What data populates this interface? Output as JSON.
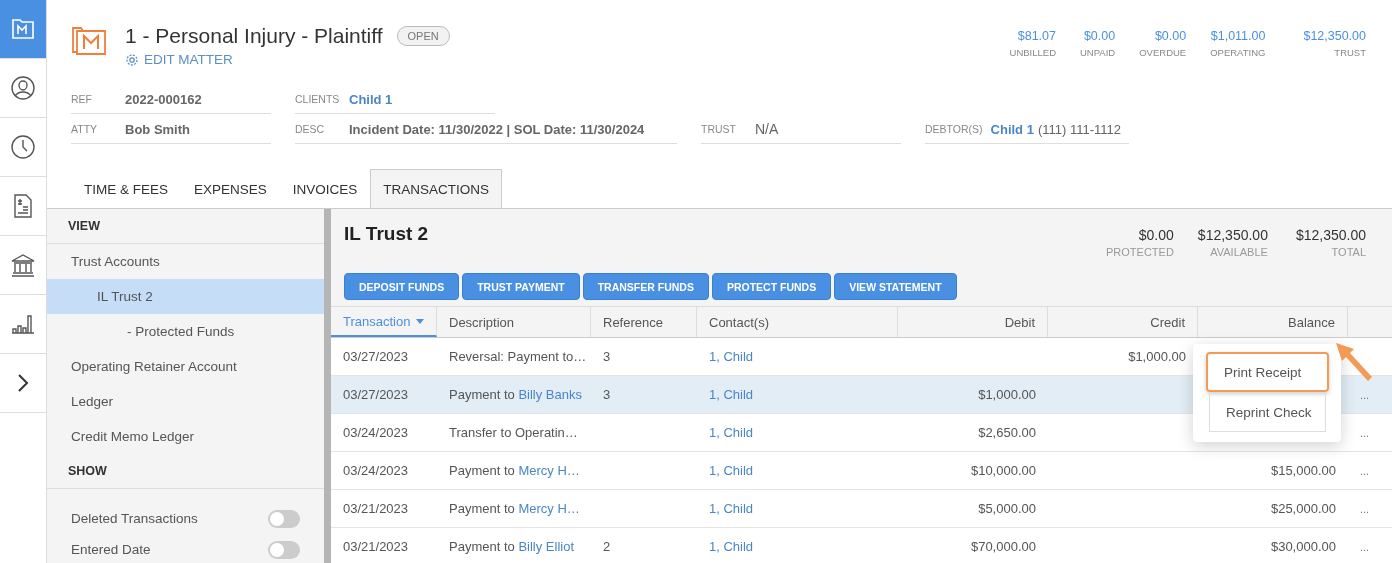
{
  "rail": [
    {
      "kind": "matter",
      "selected": true
    },
    {
      "kind": "contacts",
      "selected": false
    },
    {
      "kind": "time",
      "selected": false
    },
    {
      "kind": "invoice",
      "selected": false
    },
    {
      "kind": "bank",
      "selected": false
    },
    {
      "kind": "reports",
      "selected": false
    },
    {
      "kind": "expand",
      "selected": false
    }
  ],
  "matter": {
    "title": "1 - Personal Injury - Plaintiff",
    "status": "OPEN",
    "edit_link": "EDIT MATTER"
  },
  "stats": [
    {
      "value": "$81.07",
      "label": "UNBILLED"
    },
    {
      "value": "$0.00",
      "label": "UNPAID"
    },
    {
      "value": "$0.00",
      "label": "OVERDUE"
    },
    {
      "value": "$1,011.00",
      "label": "OPERATING"
    },
    {
      "value": "$12,350.00",
      "label": "TRUST"
    }
  ],
  "fields": [
    [
      {
        "label": "REF",
        "value": "2022-000162"
      },
      {
        "label": "CLIENTS",
        "link": "Child 1"
      }
    ],
    [
      {
        "label": "ATTY",
        "value": "Bob Smith"
      },
      {
        "label": "DESC",
        "value": "Incident Date: 11/30/2022 | SOL Date: 11/30/2024"
      },
      {
        "label": "TRUST",
        "value": "N/A"
      },
      {
        "label": "DEBTOR(S)",
        "link": "Child 1",
        "value": "(111) 111-1112"
      }
    ]
  ],
  "tabs": [
    {
      "label": "TIME & FEES",
      "selected": false
    },
    {
      "label": "EXPENSES",
      "selected": false
    },
    {
      "label": "INVOICES",
      "selected": false
    },
    {
      "label": "TRANSACTIONS",
      "selected": true
    }
  ],
  "sidebar": {
    "view_heading": "VIEW",
    "items": [
      {
        "label": "Trust Accounts",
        "selected": false,
        "children": [
          {
            "label": "IL Trust 2",
            "selected": true,
            "children": [
              {
                "label": "- Protected Funds",
                "selected": false
              }
            ]
          }
        ]
      },
      {
        "label": "Operating Retainer Account",
        "selected": false
      },
      {
        "label": "Ledger",
        "selected": false
      },
      {
        "label": "Credit Memo Ledger",
        "selected": false
      }
    ],
    "show_heading": "SHOW",
    "toggles": [
      {
        "label": "Deleted Transactions",
        "on": false
      },
      {
        "label": "Entered Date",
        "on": false
      }
    ]
  },
  "account": {
    "title": "IL Trust 2",
    "summary": [
      {
        "value": "$0.00",
        "label": "PROTECTED"
      },
      {
        "value": "$12,350.00",
        "label": "AVAILABLE"
      },
      {
        "value": "$12,350.00",
        "label": "TOTAL"
      }
    ],
    "buttons": [
      "DEPOSIT FUNDS",
      "TRUST PAYMENT",
      "TRANSFER FUNDS",
      "PROTECT FUNDS",
      "VIEW STATEMENT"
    ]
  },
  "table": {
    "columns": [
      {
        "label": "Transaction",
        "sorted": true
      },
      {
        "label": "Description",
        "sorted": false
      },
      {
        "label": "Reference",
        "sorted": false
      },
      {
        "label": "Contact(s)",
        "sorted": false
      },
      {
        "label": "Debit",
        "sorted": false
      },
      {
        "label": "Credit",
        "sorted": false
      },
      {
        "label": "Balance",
        "sorted": false
      }
    ],
    "rows": [
      {
        "date": "03/27/2023",
        "description": {
          "text": "Reversal: Payment to…"
        },
        "reference": "3",
        "contact": "1, Child",
        "credit": "$1,000.00",
        "selected": false
      },
      {
        "date": "03/27/2023",
        "description": {
          "text": "Payment to",
          "link": "Billy Banks"
        },
        "reference": "3",
        "contact": "1, Child",
        "debit": "$1,000.00",
        "menu": "...",
        "selected": true
      },
      {
        "date": "03/24/2023",
        "description": {
          "text": "Transfer to Operatin…"
        },
        "contact": "1, Child",
        "debit": "$2,650.00",
        "menu": "...",
        "selected": false
      },
      {
        "date": "03/24/2023",
        "description": {
          "text": "Payment to",
          "link": "Mercy H…"
        },
        "contact": "1, Child",
        "debit": "$10,000.00",
        "balance": "$15,000.00",
        "menu": "...",
        "selected": false
      },
      {
        "date": "03/21/2023",
        "description": {
          "text": "Payment to",
          "link": "Mercy H…"
        },
        "contact": "1, Child",
        "debit": "$5,000.00",
        "balance": "$25,000.00",
        "menu": "...",
        "selected": false
      },
      {
        "date": "03/21/2023",
        "description": {
          "text": "Payment to",
          "link": "Billy Elliot"
        },
        "reference": "2",
        "contact": "1, Child",
        "debit": "$70,000.00",
        "balance": "$30,000.00",
        "menu": "...",
        "selected": false
      }
    ]
  },
  "popup_menu": {
    "arrow": true,
    "items": [
      {
        "label": "Print Receipt",
        "highlighted": true
      },
      {
        "label": "Reprint Check",
        "highlighted": false
      }
    ]
  }
}
